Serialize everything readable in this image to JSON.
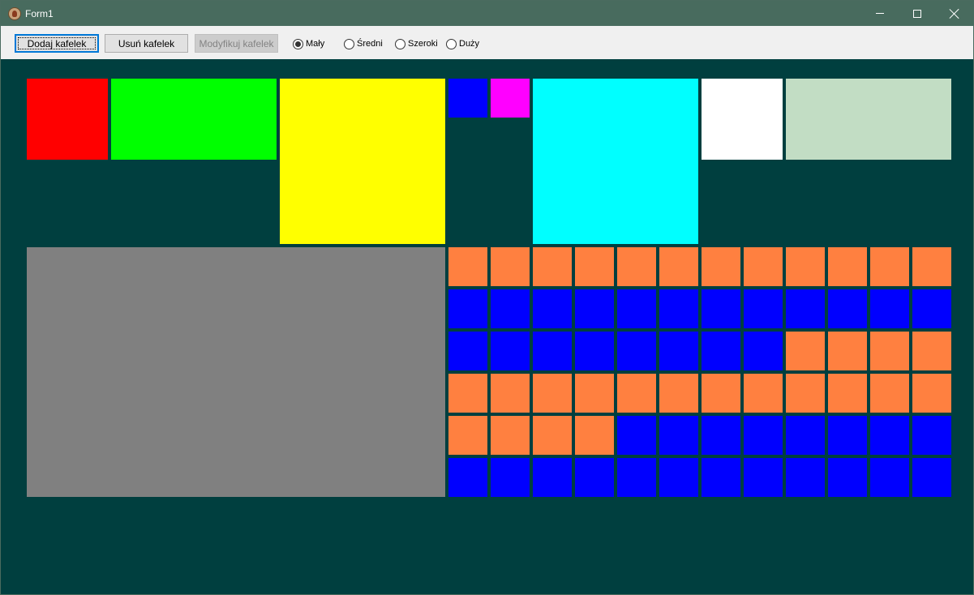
{
  "window": {
    "title": "Form1",
    "icon": "app-icon",
    "controls": [
      "minimize-icon",
      "maximize-icon",
      "close-icon"
    ]
  },
  "toolbar": {
    "add_label": "Dodaj kafelek",
    "remove_label": "Usuń kafelek",
    "modify_label": "Modyfikuj kafelek",
    "modify_enabled": false,
    "sizes": [
      {
        "label": "Mały",
        "checked": true
      },
      {
        "label": "Średni",
        "checked": false
      },
      {
        "label": "Szeroki",
        "checked": false
      },
      {
        "label": "Duży",
        "checked": false
      }
    ]
  },
  "colors": {
    "background": "#003f3f",
    "titlebar": "#486b5e",
    "red": "#ff0000",
    "green": "#00ff00",
    "yellow": "#ffff00",
    "blue": "#0000ff",
    "magenta": "#ff00ff",
    "cyan": "#00ffff",
    "white": "#ffffff",
    "light_green": "#c2ddc4",
    "gray": "#808080",
    "orange": "#ff8040"
  },
  "tiles": {
    "top_row": [
      {
        "size": "Średni",
        "color": "red"
      },
      {
        "size": "Szeroki",
        "color": "green"
      },
      {
        "size": "Duży",
        "color": "yellow"
      },
      {
        "size": "Mały",
        "color": "blue"
      },
      {
        "size": "Mały",
        "color": "magenta"
      },
      {
        "size": "Duży",
        "color": "cyan"
      },
      {
        "size": "Średni",
        "color": "white"
      },
      {
        "size": "Szeroki",
        "color": "light_green"
      }
    ],
    "large_gray_tile": {
      "color": "gray"
    },
    "small_grid": [
      "oooooooooooo",
      "bbbbbbbbbbbb",
      "bbbbbbbboooo",
      "oooooooooooo",
      "oooobbbbbbbb",
      "bbbbbbbbbbbb"
    ]
  }
}
